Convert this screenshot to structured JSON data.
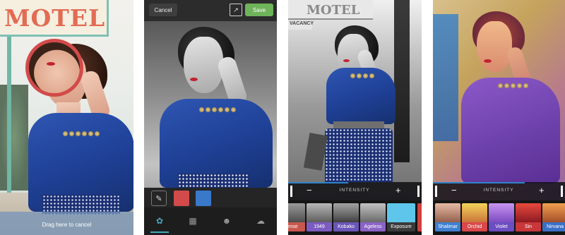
{
  "panel1": {
    "sign_text": "MOTEL",
    "drag_label": "Drag here to cancel"
  },
  "panel2": {
    "cancel_label": "Cancel",
    "save_label": "Save",
    "swatches": {
      "red": "#d24a4a",
      "blue": "#3a79c9"
    }
  },
  "panel3": {
    "sign_text": "MOTEL",
    "vacancy_text": "VACANCY",
    "intensity": {
      "label": "INTENSITY",
      "minus": "−",
      "plus": "+"
    },
    "filters": [
      {
        "label": "ense"
      },
      {
        "label": "1949"
      },
      {
        "label": "Kobako"
      },
      {
        "label": "Ageless"
      },
      {
        "label": "Exposure"
      }
    ]
  },
  "panel4": {
    "intensity": {
      "label": "INTENSITY",
      "minus": "−",
      "plus": "+"
    },
    "filters": [
      {
        "label": "Shalimar"
      },
      {
        "label": "Orchid"
      },
      {
        "label": "Violet"
      },
      {
        "label": "Sin"
      },
      {
        "label": "Nirvana"
      }
    ]
  },
  "colors": {
    "accent_teal": "#46a8b8",
    "save_green": "#6fb35a",
    "selection_red": "#d24a4a"
  }
}
